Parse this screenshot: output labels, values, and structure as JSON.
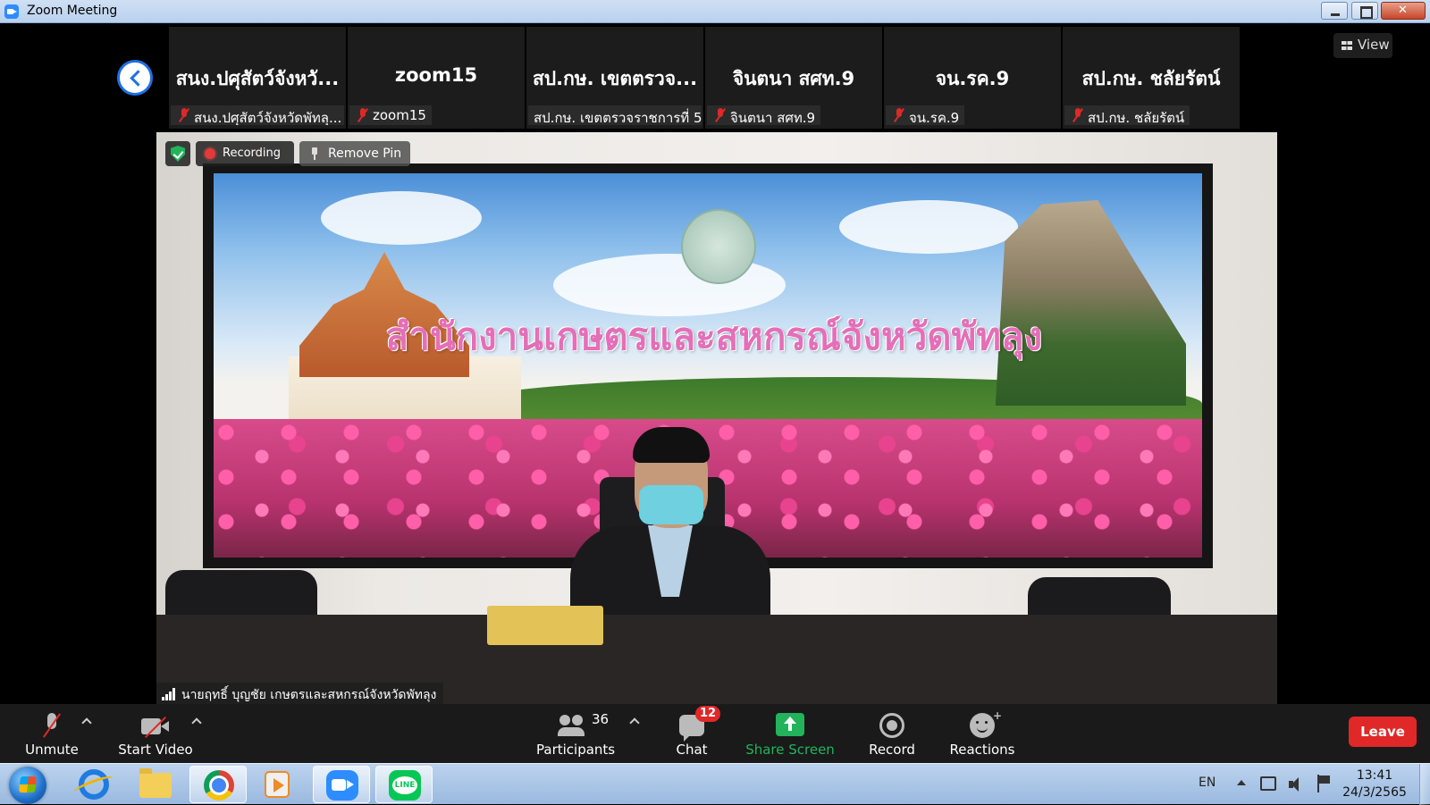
{
  "window": {
    "title": "Zoom Meeting"
  },
  "gallery": {
    "tiles": [
      {
        "name": "สนง.ปศุสัตว์จังหวั...",
        "label": "สนง.ปศุสัตว์จังหวัดพัทลุ...",
        "muted": true
      },
      {
        "name": "zoom15",
        "label": "zoom15",
        "muted": true
      },
      {
        "name": "สป.กษ. เขตตรวจ...",
        "label": "สป.กษ. เขตตรวจราชการที่ 5",
        "muted": false
      },
      {
        "name": "จินตนา  สศท.9",
        "label": "จินตนา  สศท.9",
        "muted": true
      },
      {
        "name": "จน.รค.9",
        "label": "จน.รค.9",
        "muted": true
      },
      {
        "name": "สป.กษ. ชลัยรัตน์",
        "label": "สป.กษ. ชลัยรัตน์",
        "muted": true
      }
    ],
    "view_label": "View"
  },
  "video": {
    "recording_label": "Recording",
    "remove_pin_label": "Remove Pin",
    "banner_text": "สำนักงานเกษตรและสหกรณ์จังหวัดพัทลุง",
    "speaker_name": "นายฤทธิ์ บุญชัย เกษตรและสหกรณ์จังหวัดพัทลุง"
  },
  "toolbar": {
    "unmute": "Unmute",
    "start_video": "Start Video",
    "participants": "Participants",
    "participants_count": "36",
    "chat": "Chat",
    "chat_badge": "12",
    "share_screen": "Share Screen",
    "record": "Record",
    "reactions": "Reactions",
    "leave": "Leave"
  },
  "taskbar": {
    "apps": [
      "internet-explorer-icon",
      "file-explorer-icon",
      "chrome-icon",
      "media-player-icon",
      "zoom-icon",
      "line-icon"
    ],
    "line_text": "LINE",
    "language": "EN",
    "time": "13:41",
    "date": "24/3/2565"
  },
  "colors": {
    "accent_blue": "#1f6fe5",
    "leave_red": "#e02828",
    "share_green": "#23b35b",
    "muted_red": "#e02828"
  }
}
